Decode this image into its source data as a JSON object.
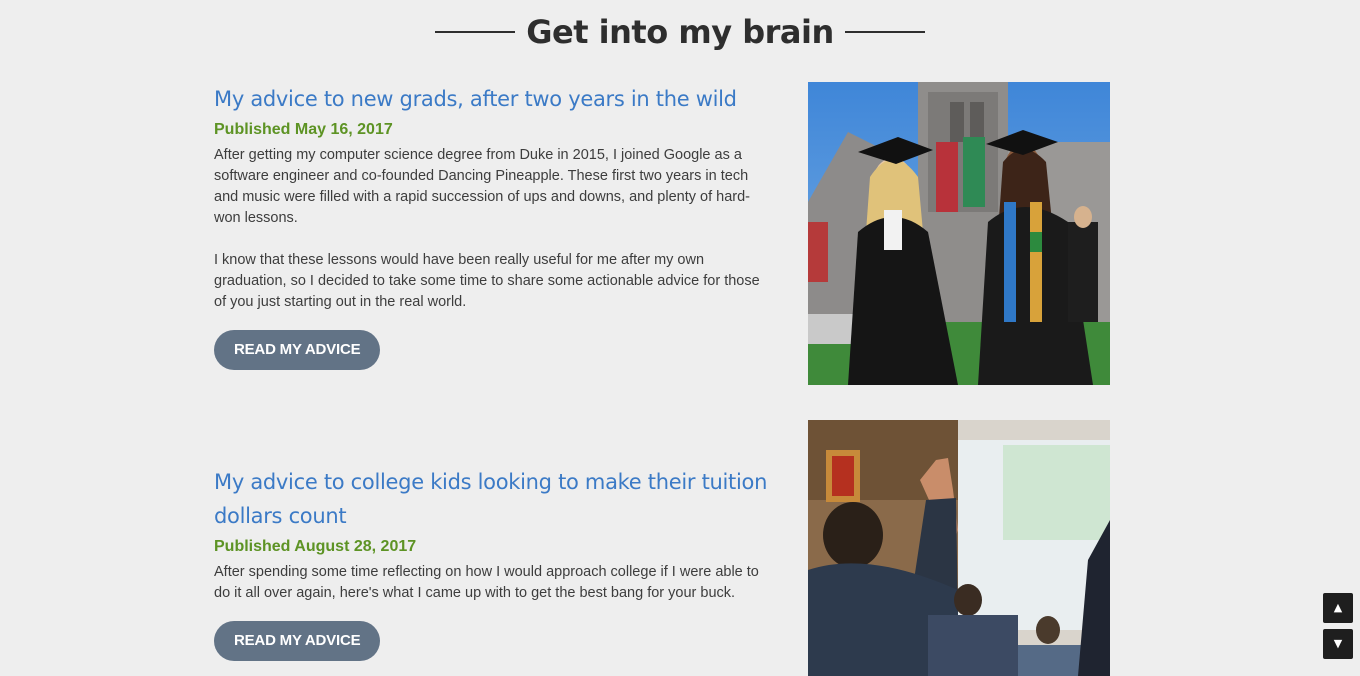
{
  "section": {
    "heading": "Get into my brain"
  },
  "posts": [
    {
      "title": "My advice to new grads, after two years in the wild",
      "date": "Published May 16, 2017",
      "paragraphs": [
        "After getting my computer science degree from Duke in 2015, I joined Google as a software engineer and co-founded Dancing Pineapple. These first two years in tech and music were filled with a rapid succession of ups and downs, and plenty of hard-won lessons.",
        "I know that these lessons would have been really useful for me after my own graduation, so I decided to take some time to share some actionable advice for those of you just starting out in the real world."
      ],
      "button_label": "READ MY ADVICE"
    },
    {
      "title": "My advice to college kids looking to make their tuition dollars count",
      "date": "Published August 28, 2017",
      "paragraphs": [
        "After spending some time reflecting on how I would approach college if I were able to do it all over again, here's what I came up with to get the best bang for your buck."
      ],
      "button_label": "READ MY ADVICE"
    }
  ],
  "scroll_controls": {
    "up_icon": "▲",
    "down_icon": "▼"
  }
}
